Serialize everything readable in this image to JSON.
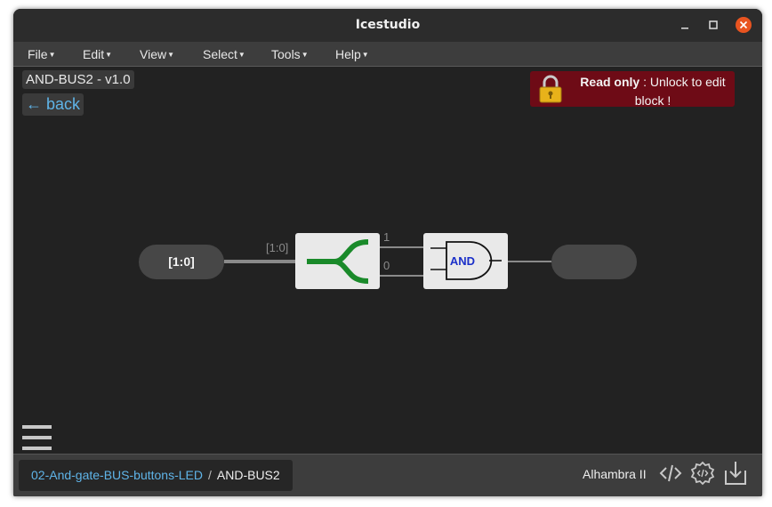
{
  "window": {
    "title": "Icestudio"
  },
  "menu": [
    {
      "label": "File",
      "name": "menu-file"
    },
    {
      "label": "Edit",
      "name": "menu-edit"
    },
    {
      "label": "View",
      "name": "menu-view"
    },
    {
      "label": "Select",
      "name": "menu-select"
    },
    {
      "label": "Tools",
      "name": "menu-tools"
    },
    {
      "label": "Help",
      "name": "menu-help"
    }
  ],
  "canvas": {
    "block_title": "AND-BUS2 - v1.0",
    "back_label": "← back",
    "readonly": {
      "bold": "Read only",
      "rest": " : Unlock to edit block !"
    },
    "input_port": {
      "label": "[1:0]"
    },
    "bus_wire_label": "[1:0]",
    "split_labels": [
      "1",
      "0"
    ],
    "and_gate_label": "AND"
  },
  "statusbar": {
    "breadcrumb": {
      "parent": "02-And-gate-BUS-buttons-LED",
      "separator": "/",
      "current": "AND-BUS2"
    },
    "board": "Alhambra II"
  },
  "colors": {
    "accent_link": "#5fb4e8",
    "readonly_bg": "#6e0b16",
    "split_green": "#1a8a2a",
    "and_text": "#1a2fc9"
  },
  "icons": [
    "lock-icon",
    "hamburger-icon",
    "code-icon",
    "gear-icon",
    "download-icon",
    "minimize-icon",
    "maximize-icon",
    "close-icon"
  ]
}
